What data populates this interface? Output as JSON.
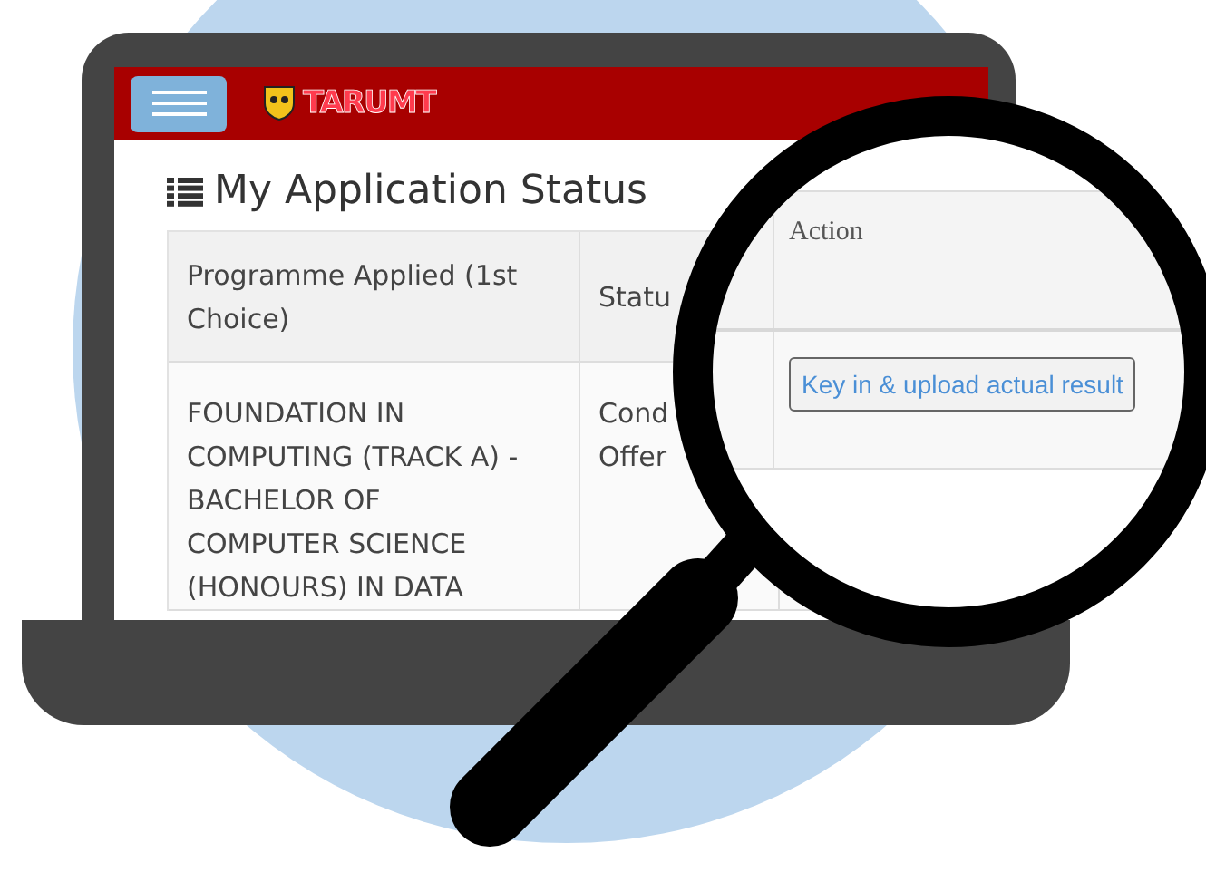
{
  "header": {
    "logo": {
      "part_1": "TAR",
      "part_2": "UMT"
    }
  },
  "page": {
    "title": "My Application Status"
  },
  "table": {
    "columns": [
      "Programme Applied (1st Choice)",
      "Statu"
    ],
    "rows": [
      {
        "cells": [
          "FOUNDATION IN COMPUTING (TRACK A) - BACHELOR OF COMPUTER SCIENCE (HONOURS) IN DATA",
          [
            "Cond",
            "Offer"
          ]
        ]
      }
    ]
  },
  "magnified": {
    "column": "Action",
    "button": "Key in & upload actual result"
  }
}
